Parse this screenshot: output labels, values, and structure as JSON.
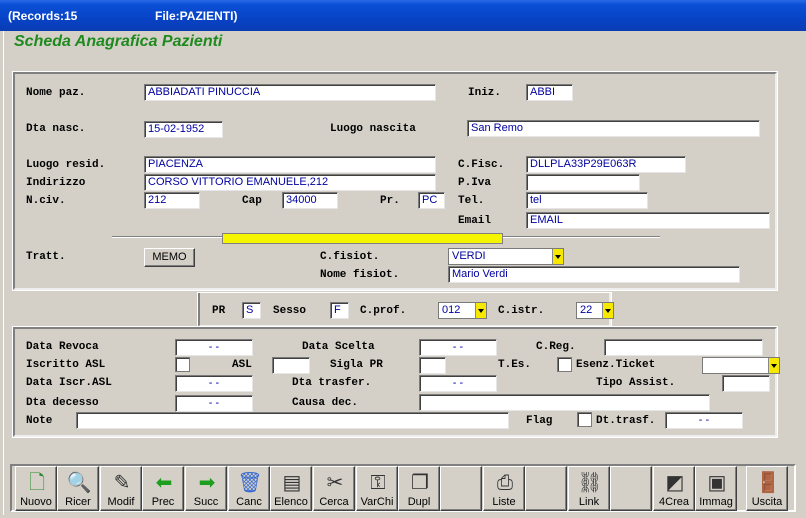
{
  "titlebar": {
    "records": "(Records:15",
    "file": "File:PAZIENTI)"
  },
  "header": {
    "title": "Scheda Anagrafica Pazienti"
  },
  "patient": {
    "nome_label": "Nome paz.",
    "nome_value": "ABBIADATI PINUCCIA",
    "iniz_label": "Iniz.",
    "iniz_value": "ABBI",
    "dta_nasc_label": "Dta nasc.",
    "dta_nasc_value": "15-02-1952",
    "luogo_nascita_label": "Luogo nascita",
    "luogo_nascita_value": "San Remo",
    "luogo_resid_label": "Luogo resid.",
    "luogo_resid_value": "PIACENZA",
    "cfisc_label": "C.Fisc.",
    "cfisc_value": "DLLPLA33P29E063R",
    "indirizzo_label": "Indirizzo",
    "indirizzo_value": "CORSO VITTORIO EMANUELE,212",
    "piva_label": "P.Iva",
    "piva_value": "",
    "nciv_label": "N.civ.",
    "nciv_value": "212",
    "cap_label": "Cap",
    "cap_value": "34000",
    "pr_label": "Pr.",
    "pr_value": "PC",
    "tel_label": "Tel.",
    "tel_value": "tel",
    "email_label": "Email",
    "email_value": "EMAIL",
    "tratt_label": "Tratt.",
    "memo_label": "MEMO",
    "cfisiot_label": "C.fisiot.",
    "cfisiot_value": "VERDI",
    "nome_fisiot_label": "Nome fisiot.",
    "nome_fisiot_value": "Mario Verdi"
  },
  "middle": {
    "pr_label": "PR",
    "pr_value": "S",
    "sesso_label": "Sesso",
    "sesso_value": "F",
    "cprof_label": "C.prof.",
    "cprof_value": "012",
    "cistr_label": "C.istr.",
    "cistr_value": "22"
  },
  "admin": {
    "data_revoca_label": "Data Revoca",
    "data_revoca_value": "-   -",
    "data_scelta_label": "Data Scelta",
    "data_scelta_value": "-   -",
    "creg_label": "C.Reg.",
    "creg_value": "",
    "iscritto_asl_label": "Iscritto ASL",
    "asl_label": "ASL",
    "asl_value": "",
    "sigla_pr_label": "Sigla PR",
    "sigla_pr_value": "",
    "tes_label": "T.Es.",
    "esenz_label": "Esenz.Ticket",
    "esenz_value": "",
    "data_iscr_label": "Data Iscr.ASL",
    "data_iscr_value": "-   -",
    "dta_trasfer_label": "Dta trasfer.",
    "dta_trasfer_value": "-   -",
    "tipo_assist_label": "Tipo Assist.",
    "tipo_assist_value": "",
    "dta_decesso_label": "Dta decesso",
    "dta_decesso_value": "-   -",
    "causa_dec_label": "Causa dec.",
    "causa_dec_value": "",
    "note_label": "Note",
    "note_value": "",
    "flag_label": "Flag",
    "dt_trasf_label": "Dt.trasf.",
    "dt_trasf_value": "-   -"
  },
  "toolbar": [
    {
      "label": "Nuovo",
      "icon": "new-record-icon",
      "glyph": "🗋"
    },
    {
      "label": "Ricer",
      "icon": "search-icon",
      "glyph": "🔍"
    },
    {
      "label": "Modif",
      "icon": "edit-icon",
      "glyph": "✎"
    },
    {
      "label": "Prec",
      "icon": "arrow-left-icon",
      "glyph": "⬅"
    },
    {
      "label": "Succ",
      "icon": "arrow-right-icon",
      "glyph": "➡"
    },
    {
      "label": "Canc",
      "icon": "trash-icon",
      "glyph": "🗑"
    },
    {
      "label": "Elenco",
      "icon": "list-icon",
      "glyph": "▤"
    },
    {
      "label": "Cerca",
      "icon": "find-icon",
      "glyph": "✂"
    },
    {
      "label": "VarChi",
      "icon": "keys-icon",
      "glyph": "⚿"
    },
    {
      "label": "Dupl",
      "icon": "duplicate-icon",
      "glyph": "❐"
    },
    {
      "label": "",
      "icon": "",
      "glyph": ""
    },
    {
      "label": "Liste",
      "icon": "printer-icon",
      "glyph": "⎙"
    },
    {
      "label": "",
      "icon": "",
      "glyph": ""
    },
    {
      "label": "Link",
      "icon": "link-icon",
      "glyph": "⛓"
    },
    {
      "label": "",
      "icon": "",
      "glyph": ""
    },
    {
      "label": "4Crea",
      "icon": "create-icon",
      "glyph": "◩"
    },
    {
      "label": "Immag",
      "icon": "image-icon",
      "glyph": "▣"
    },
    {
      "label": "",
      "icon": "",
      "glyph": ""
    },
    {
      "label": "Uscita",
      "icon": "exit-door-icon",
      "glyph": "🚪"
    }
  ]
}
